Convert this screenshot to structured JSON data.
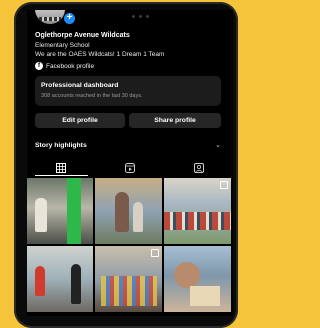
{
  "profile": {
    "name": "Oglethorpe Avenue Wildcats",
    "bio_line1": "Elementary School",
    "bio_line2": "We are the OAES Wildcats! 1 Dream 1 Team",
    "facebook_label": "Facebook profile"
  },
  "dashboard": {
    "title": "Professional dashboard",
    "subtitle": "308 accounts reached in the last 30 days."
  },
  "actions": {
    "edit_label": "Edit profile",
    "share_label": "Share profile"
  },
  "highlights": {
    "label": "Story highlights"
  },
  "tabs": [
    {
      "icon": "grid-icon",
      "active": true
    },
    {
      "icon": "reels-icon",
      "active": false
    },
    {
      "icon": "tagged-icon",
      "active": false
    }
  ],
  "colors": {
    "background": "#f5c43a",
    "screen": "#000000",
    "accent": "#1d8cf8",
    "button": "#262626"
  },
  "posts": [
    {
      "description": "students with green wall",
      "reel": false
    },
    {
      "description": "two girls at school event",
      "reel": false
    },
    {
      "description": "students with flags",
      "reel": true
    },
    {
      "description": "students on field",
      "reel": false
    },
    {
      "description": "group of students with letters",
      "reel": true
    },
    {
      "description": "children at table",
      "reel": false
    }
  ]
}
